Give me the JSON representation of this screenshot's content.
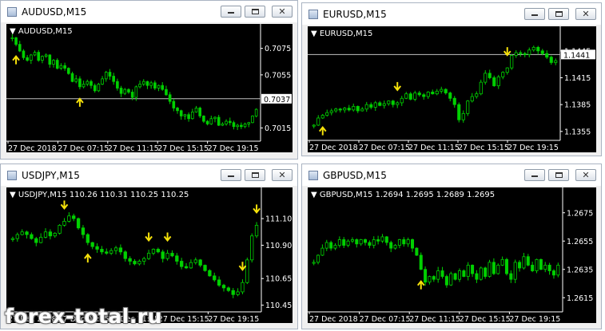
{
  "watermark": "forex-total.ru",
  "colors": {
    "bull": "#00d000",
    "bear": "#00d000",
    "grid_text": "#ffffff",
    "arrow": "#f6e20a",
    "price_line": "#c0c0c0",
    "plot_bg": "#000000"
  },
  "windows": [
    {
      "title": "AUDUSD,M15",
      "symbol_label": "AUDUSD,M15",
      "price_label": "0.7037",
      "y_ticks": [
        "0.7075",
        "0.7055",
        "0.7015"
      ],
      "x_ticks": [
        "27 Dec 2018",
        "27 Dec 07:15",
        "27 Dec 11:15",
        "27 Dec 15:15",
        "27 Dec 19:15"
      ],
      "ylim": [
        0.7005,
        0.7085
      ],
      "price_line": 0.7037,
      "series": [
        0.7083,
        0.7078,
        0.7073,
        0.7068,
        0.7066,
        0.707,
        0.7072,
        0.7066,
        0.7069,
        0.707,
        0.7063,
        0.7066,
        0.706,
        0.7062,
        0.706,
        0.7056,
        0.705,
        0.7052,
        0.7046,
        0.7048,
        0.705,
        0.7047,
        0.7043,
        0.7048,
        0.7052,
        0.7057,
        0.7054,
        0.705,
        0.7045,
        0.7041,
        0.7044,
        0.7042,
        0.7038,
        0.7046,
        0.7048,
        0.705,
        0.7047,
        0.7049,
        0.7045,
        0.7047,
        0.7044,
        0.704,
        0.7035,
        0.703,
        0.7028,
        0.7024,
        0.7025,
        0.7022,
        0.7027,
        0.703,
        0.7024,
        0.702,
        0.7018,
        0.7022,
        0.7023,
        0.7017,
        0.7018,
        0.702,
        0.7019,
        0.7016,
        0.7017,
        0.7016,
        0.7018,
        0.7019,
        0.7024,
        0.7029
      ],
      "arrows": [
        {
          "i": 1,
          "dir": "up"
        },
        {
          "i": 18,
          "dir": "up"
        }
      ]
    },
    {
      "title": "EURUSD,M15",
      "symbol_label": "EURUSD,M15",
      "price_label": "1.1441",
      "y_ticks": [
        "1.1445",
        "1.1415",
        "1.1385",
        "1.1355"
      ],
      "x_ticks": [
        "27 Dec 2018",
        "27 Dec 07:15",
        "27 Dec 11:15",
        "27 Dec 15:15",
        "27 Dec 19:15"
      ],
      "ylim": [
        1.1345,
        1.146
      ],
      "price_line": 1.1441,
      "series": [
        1.1362,
        1.137,
        1.1373,
        1.1376,
        1.1378,
        1.138,
        1.1379,
        1.1381,
        1.1379,
        1.1383,
        1.1378,
        1.138,
        1.1385,
        1.1382,
        1.1387,
        1.1384,
        1.1386,
        1.1389,
        1.1385,
        1.1387,
        1.1392,
        1.1397,
        1.1391,
        1.1398,
        1.1396,
        1.1394,
        1.1399,
        1.1397,
        1.14,
        1.1402,
        1.1398,
        1.1392,
        1.1385,
        1.1368,
        1.1375,
        1.1389,
        1.1394,
        1.1397,
        1.141,
        1.142,
        1.1415,
        1.1406,
        1.1416,
        1.1421,
        1.1426,
        1.144,
        1.1443,
        1.1442,
        1.1441,
        1.1446,
        1.1449,
        1.1445,
        1.1442,
        1.1438,
        1.1432,
        1.1434
      ],
      "arrows": [
        {
          "i": 2,
          "dir": "up"
        },
        {
          "i": 19,
          "dir": "down"
        },
        {
          "i": 44,
          "dir": "down"
        }
      ]
    },
    {
      "title": "USDJPY,M15",
      "symbol_label": "USDJPY,M15  110.26 110.31 110.25 110.25",
      "price_label": "",
      "y_ticks": [
        "111.10",
        "110.90",
        "110.65",
        "110.45"
      ],
      "x_ticks": [
        "27 Dec 2018",
        "27 Dec 07:15",
        "27 Dec 11:15",
        "27 Dec 15:15",
        "27 Dec 19:15"
      ],
      "ylim": [
        110.4,
        111.25
      ],
      "price_line": null,
      "series": [
        110.95,
        110.98,
        111.0,
        110.98,
        110.95,
        110.92,
        110.96,
        111.0,
        110.97,
        110.99,
        111.05,
        111.08,
        111.12,
        111.1,
        111.03,
        110.98,
        110.92,
        110.89,
        110.87,
        110.85,
        110.84,
        110.86,
        110.88,
        110.85,
        110.8,
        110.78,
        110.76,
        110.78,
        110.8,
        110.84,
        110.87,
        110.85,
        110.8,
        110.84,
        110.82,
        110.78,
        110.74,
        110.73,
        110.77,
        110.79,
        110.75,
        110.71,
        110.67,
        110.64,
        110.6,
        110.58,
        110.56,
        110.53,
        110.55,
        110.62,
        110.79,
        110.97,
        111.05
      ],
      "arrows": [
        {
          "i": 11,
          "dir": "down"
        },
        {
          "i": 16,
          "dir": "up"
        },
        {
          "i": 29,
          "dir": "down"
        },
        {
          "i": 33,
          "dir": "down"
        },
        {
          "i": 49,
          "dir": "down"
        },
        {
          "i": 52,
          "dir": "down"
        }
      ]
    },
    {
      "title": "GBPUSD,M15",
      "symbol_label": "GBPUSD,M15  1.2694 1.2695 1.2689 1.2695",
      "price_label": "",
      "y_ticks": [
        "1.2675",
        "1.2655",
        "1.2635",
        "1.2615"
      ],
      "x_ticks": [
        "27 Dec 2018",
        "27 Dec 07:15",
        "27 Dec 11:15",
        "27 Dec 15:15",
        "27 Dec 19:15"
      ],
      "ylim": [
        1.2605,
        1.2685
      ],
      "price_line": null,
      "series": [
        1.264,
        1.2645,
        1.265,
        1.2654,
        1.265,
        1.2652,
        1.2656,
        1.2652,
        1.2655,
        1.2656,
        1.2653,
        1.2656,
        1.2654,
        1.2652,
        1.2656,
        1.2655,
        1.2658,
        1.2654,
        1.265,
        1.2652,
        1.2656,
        1.2653,
        1.2656,
        1.265,
        1.2645,
        1.2635,
        1.2626,
        1.263,
        1.2628,
        1.2634,
        1.263,
        1.2624,
        1.2632,
        1.2628,
        1.2634,
        1.263,
        1.2638,
        1.2632,
        1.2628,
        1.2636,
        1.263,
        1.264,
        1.2632,
        1.2638,
        1.2642,
        1.2632,
        1.2628,
        1.264,
        1.2636,
        1.2644,
        1.2638,
        1.2634,
        1.2642,
        1.2635,
        1.2638,
        1.2634,
        1.2631,
        1.2638
      ],
      "arrows": [
        {
          "i": 25,
          "dir": "up"
        }
      ]
    }
  ]
}
